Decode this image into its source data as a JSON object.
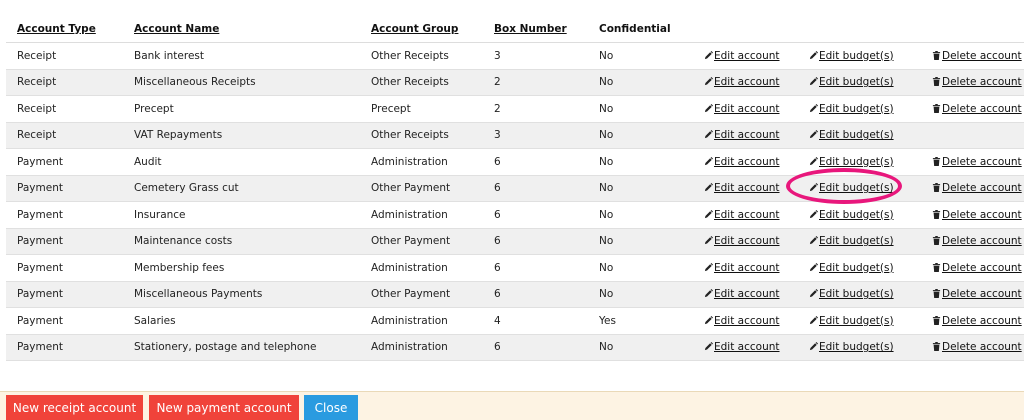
{
  "table": {
    "headers": {
      "account_type": "Account Type",
      "account_name": "Account Name",
      "account_group": "Account Group",
      "box_number": "Box Number",
      "confidential": "Confidential"
    },
    "actions": {
      "edit_account": "Edit account",
      "edit_budget": "Edit budget(s)",
      "delete_account": "Delete account"
    },
    "rows": [
      {
        "type": "Receipt",
        "name": "Bank interest",
        "group": "Other Receipts",
        "box": "3",
        "confidential": "No",
        "can_delete": true
      },
      {
        "type": "Receipt",
        "name": "Miscellaneous Receipts",
        "group": "Other Receipts",
        "box": "2",
        "confidential": "No",
        "can_delete": true
      },
      {
        "type": "Receipt",
        "name": "Precept",
        "group": "Precept",
        "box": "2",
        "confidential": "No",
        "can_delete": true
      },
      {
        "type": "Receipt",
        "name": "VAT Repayments",
        "group": "Other Receipts",
        "box": "3",
        "confidential": "No",
        "can_delete": false
      },
      {
        "type": "Payment",
        "name": "Audit",
        "group": "Administration",
        "box": "6",
        "confidential": "No",
        "can_delete": true
      },
      {
        "type": "Payment",
        "name": "Cemetery Grass cut",
        "group": "Other Payment",
        "box": "6",
        "confidential": "No",
        "can_delete": true
      },
      {
        "type": "Payment",
        "name": "Insurance",
        "group": "Administration",
        "box": "6",
        "confidential": "No",
        "can_delete": true
      },
      {
        "type": "Payment",
        "name": "Maintenance costs",
        "group": "Other Payment",
        "box": "6",
        "confidential": "No",
        "can_delete": true
      },
      {
        "type": "Payment",
        "name": "Membership fees",
        "group": "Administration",
        "box": "6",
        "confidential": "No",
        "can_delete": true
      },
      {
        "type": "Payment",
        "name": "Miscellaneous Payments",
        "group": "Other Payment",
        "box": "6",
        "confidential": "No",
        "can_delete": true
      },
      {
        "type": "Payment",
        "name": "Salaries",
        "group": "Administration",
        "box": "4",
        "confidential": "Yes",
        "can_delete": true
      },
      {
        "type": "Payment",
        "name": "Stationery, postage and telephone",
        "group": "Administration",
        "box": "6",
        "confidential": "No",
        "can_delete": true
      }
    ]
  },
  "footer": {
    "new_receipt": "New receipt account",
    "new_payment": "New payment account",
    "close": "Close"
  },
  "colors": {
    "red_button": "#f0433a",
    "blue_button": "#2a9be0",
    "highlight": "#e8177c",
    "footer_bg": "#fdf3e3"
  },
  "icons": {
    "edit": "pencil-icon",
    "delete": "trash-icon"
  }
}
